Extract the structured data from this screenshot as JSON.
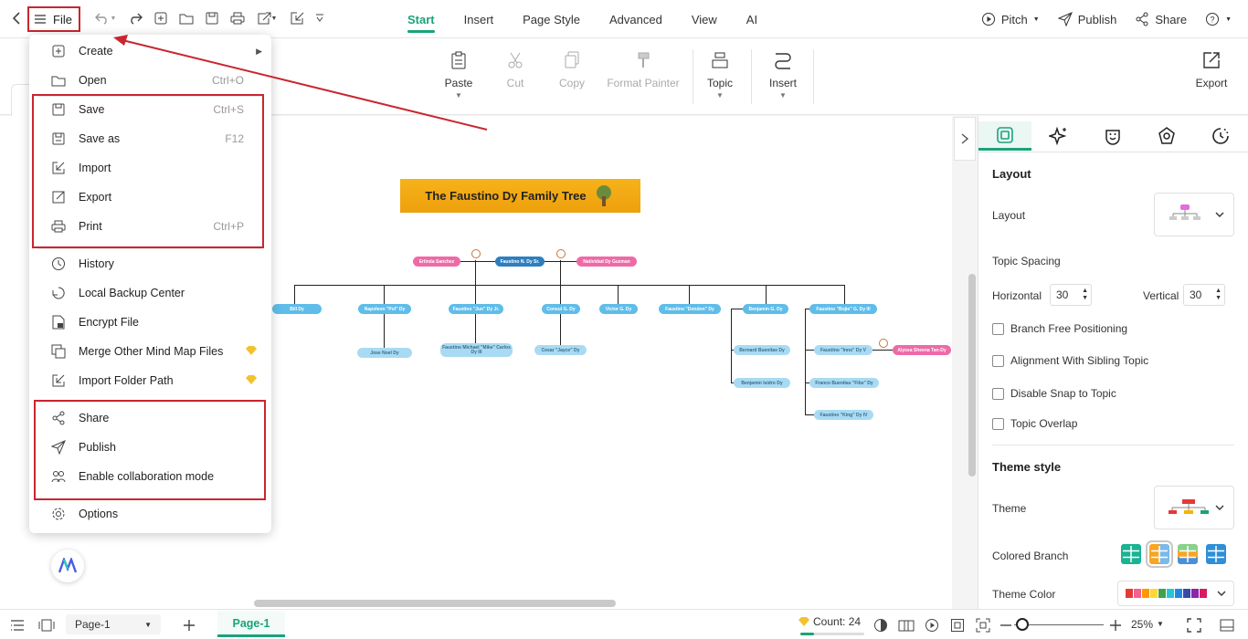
{
  "topbar": {
    "file_label": "File",
    "tabs": [
      {
        "label": "Start",
        "active": true
      },
      {
        "label": "Insert"
      },
      {
        "label": "Page Style"
      },
      {
        "label": "Advanced"
      },
      {
        "label": "View"
      },
      {
        "label": "AI"
      }
    ],
    "pitch_label": "Pitch",
    "publish_label": "Publish",
    "share_label": "Share"
  },
  "ribbon": {
    "paste": "Paste",
    "cut": "Cut",
    "copy": "Copy",
    "format_painter": "Format Painter",
    "topic": "Topic",
    "insert": "Insert",
    "export": "Export"
  },
  "file_menu": {
    "items": [
      {
        "label": "Create",
        "icon": "plus-square-icon"
      },
      {
        "label": "Open",
        "shortcut": "Ctrl+O",
        "icon": "folder-icon"
      },
      {
        "label": "Save",
        "shortcut": "Ctrl+S",
        "icon": "save-icon"
      },
      {
        "label": "Save as",
        "shortcut": "F12",
        "icon": "save-as-icon"
      },
      {
        "label": "Import",
        "icon": "import-icon"
      },
      {
        "label": "Export",
        "icon": "export-icon"
      },
      {
        "label": "Print",
        "shortcut": "Ctrl+P",
        "icon": "print-icon"
      },
      {
        "label": "History",
        "icon": "history-icon"
      },
      {
        "label": "Local Backup Center",
        "icon": "backup-icon"
      },
      {
        "label": "Encrypt File",
        "icon": "lock-file-icon"
      },
      {
        "label": "Merge Other Mind Map Files",
        "icon": "merge-icon",
        "premium": true
      },
      {
        "label": "Import Folder Path",
        "icon": "folder-import-icon",
        "premium": true
      },
      {
        "label": "Share",
        "icon": "share-icon"
      },
      {
        "label": "Publish",
        "icon": "send-icon"
      },
      {
        "label": "Enable collaboration mode",
        "icon": "collaboration-icon"
      },
      {
        "label": "Options",
        "icon": "gear-icon"
      }
    ]
  },
  "mindmap": {
    "title": "The Faustino Dy Family Tree",
    "root": "Faustino N. Dy Sr.",
    "spouse_left": "Erlinda Sanchez",
    "spouse_right": "Natividad Dy Guzman",
    "children": [
      "Bill Dy",
      "Napoleon \"Pol\" Dy",
      "Faustino \"Jun\" Dy Jr.",
      "Consul G. Dy",
      "Victor G. Dy",
      "Faustino \"Dondon\" Dy",
      "Benjamin G. Dy",
      "Faustino \"Bojie\" G. Dy III"
    ],
    "grandchildren": {
      "napoleon": "Jose Noel Dy",
      "jun": "Faustino Michael \"Mike\" Carlos Dy III",
      "consul": "Cesar \"Jayce\" Dy",
      "benjamin_1": "Bernard Buenitas Dy",
      "benjamin_2": "Benjamin Isidro Dy",
      "bojie_1": "Faustino \"Inno\" Dy V",
      "bojie_spouse": "Alyssa Sheena Tan-Dy",
      "bojie_2": "Franco Buenitas \"Fibs\" Dy",
      "bojie_3": "Faustino \"King\" Dy IV"
    }
  },
  "panel": {
    "layout_heading": "Layout",
    "layout_label": "Layout",
    "topic_spacing": "Topic Spacing",
    "horizontal_label": "Horizontal",
    "horizontal_value": "30",
    "vertical_label": "Vertical",
    "vertical_value": "30",
    "checkboxes": [
      {
        "label": "Branch Free Positioning",
        "checked": false
      },
      {
        "label": "Alignment With Sibling Topic",
        "checked": false
      },
      {
        "label": "Disable Snap to Topic",
        "checked": false
      },
      {
        "label": "Topic Overlap",
        "checked": false
      }
    ],
    "theme_style_heading": "Theme style",
    "theme_label": "Theme",
    "colored_branch_label": "Colored Branch",
    "theme_color_label": "Theme Color"
  },
  "statusbar": {
    "page_select": "Page-1",
    "page_tab": "Page-1",
    "count_label": "Count: 24",
    "count_progress": 0.22,
    "zoom": "25%"
  },
  "colors": {
    "accent": "#1aa37a",
    "annotation_red": "#c9262f",
    "title_orange": "#f0a30f",
    "node_blue": "#5fbde9",
    "node_pink": "#ee6aa7"
  }
}
